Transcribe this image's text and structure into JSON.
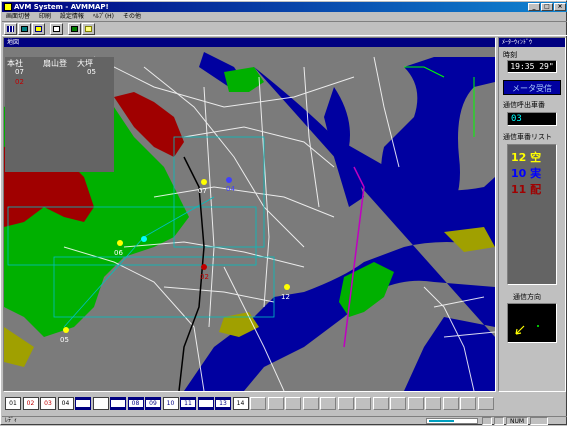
{
  "window": {
    "title": "AVM System - AVMMAP!",
    "controls": [
      "_",
      "□",
      "×"
    ]
  },
  "menu": [
    "画面切替",
    "印刷",
    "設定情報",
    "ﾍﾙﾌﾟ(H)",
    "その他"
  ],
  "toolbar_icons": [
    "grid-icon",
    "layers-icon",
    "map-pin-icon",
    "document-icon",
    "terminal-icon",
    "table-icon"
  ],
  "map": {
    "header": "地図",
    "vehicle_list": {
      "headers": [
        "本社",
        "扇山登",
        "大坪"
      ],
      "row1": [
        "07",
        "",
        "05"
      ],
      "row2": [
        "02",
        "",
        ""
      ]
    },
    "markers": [
      {
        "label": "07",
        "color": "#ffff00"
      },
      {
        "label": "04",
        "color": "#4040ff"
      },
      {
        "label": "06",
        "color": "#ffff00"
      },
      {
        "label": "02",
        "color": "#c00000"
      },
      {
        "label": "12",
        "color": "#ffff00"
      },
      {
        "label": "05",
        "color": "#ffff00"
      }
    ]
  },
  "side": {
    "header": "ﾒｰﾀｰｳｨﾝﾄﾞｳ",
    "time_label": "時刻",
    "time_value": "19:35 29\"",
    "receive_button": "メータ受信",
    "call_label": "通信呼出車番",
    "call_value": "03",
    "comm_list_label": "通信車番リスト",
    "comm_rows": [
      {
        "num": "12",
        "status": "空",
        "color": "#ffff00"
      },
      {
        "num": "10",
        "status": "実",
        "color": "#0000ff"
      },
      {
        "num": "11",
        "status": "配",
        "color": "#a00000"
      }
    ],
    "direction_label": "通信方向"
  },
  "vehicle_buttons": [
    {
      "label": "01",
      "color": "#000000",
      "selected": false
    },
    {
      "label": "02",
      "color": "#c00000",
      "selected": false
    },
    {
      "label": "03",
      "color": "#c00000",
      "selected": false
    },
    {
      "label": "04",
      "color": "#000000",
      "selected": false
    },
    {
      "label": "",
      "color": "#000000",
      "selected": true
    },
    {
      "label": "",
      "color": "#c0c000",
      "selected": false
    },
    {
      "label": "",
      "color": "#000000",
      "selected": true
    },
    {
      "label": "08",
      "color": "#000080",
      "selected": true
    },
    {
      "label": "09",
      "color": "#000080",
      "selected": true
    },
    {
      "label": "10",
      "color": "#000080",
      "selected": false
    },
    {
      "label": "11",
      "color": "#000080",
      "selected": true
    },
    {
      "label": "",
      "color": "#000000",
      "selected": true
    },
    {
      "label": "13",
      "color": "#000080",
      "selected": true
    },
    {
      "label": "14",
      "color": "#000000",
      "selected": false
    }
  ],
  "status": {
    "ready": "ﾚﾃﾞｨ",
    "progress": 0.55,
    "num": "NUM"
  }
}
